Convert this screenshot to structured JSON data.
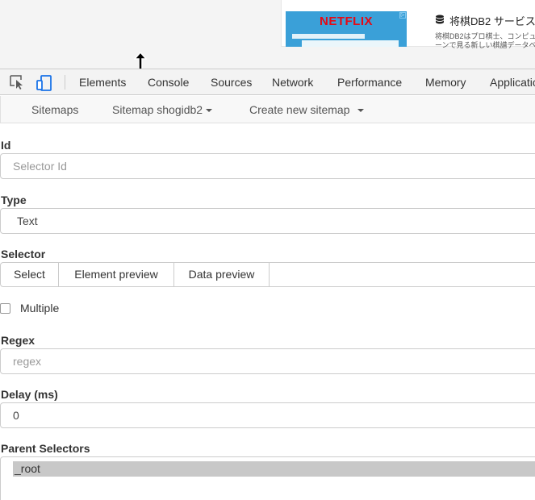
{
  "webpage": {
    "ad": {
      "brand": "NETFLIX",
      "adchoices": "▷",
      "title": "将棋DB2 サービス",
      "description_line1": "将棋DB2はプロ棋士、コンピュ",
      "description_line2": "ーンで見る新しい棋譜データベ"
    }
  },
  "devtools": {
    "tabs": [
      "Elements",
      "Console",
      "Sources",
      "Network",
      "Performance",
      "Memory",
      "Application"
    ]
  },
  "scraper": {
    "nav": {
      "sitemaps": "Sitemaps",
      "sitemap_current": "Sitemap shogidb2",
      "create_new": "Create new sitemap"
    },
    "form": {
      "id_label": "Id",
      "id_placeholder": "Selector Id",
      "type_label": "Type",
      "type_value": "Text",
      "selector_label": "Selector",
      "selector_buttons": [
        "Select",
        "Element preview",
        "Data preview"
      ],
      "multiple_label": "Multiple",
      "multiple_checked": false,
      "regex_label": "Regex",
      "regex_placeholder": "regex",
      "delay_label": "Delay (ms)",
      "delay_value": "0",
      "parent_label": "Parent Selectors",
      "parent_options": [
        "_root"
      ]
    }
  }
}
